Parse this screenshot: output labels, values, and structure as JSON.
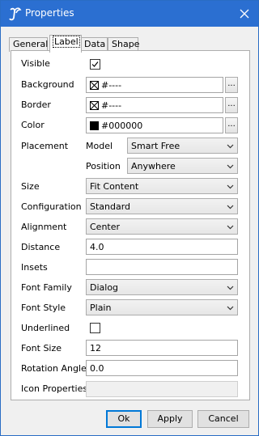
{
  "window": {
    "title": "Properties",
    "app_icon": "yed-logo-icon",
    "close_icon": "close-icon"
  },
  "tabs": [
    {
      "label": "General",
      "active": false
    },
    {
      "label": "Label",
      "active": true
    },
    {
      "label": "Data",
      "active": false
    },
    {
      "label": "Shape",
      "active": false
    }
  ],
  "form": {
    "visible": {
      "label": "Visible",
      "checked": true
    },
    "background": {
      "label": "Background",
      "value": "#----",
      "swatch": "none",
      "button": "..."
    },
    "border": {
      "label": "Border",
      "value": "#----",
      "swatch": "none",
      "button": "..."
    },
    "color": {
      "label": "Color",
      "value": "#000000",
      "swatch": "#000000",
      "button": "..."
    },
    "placement": {
      "label": "Placement",
      "model_label": "Model",
      "model_value": "Smart Free",
      "position_label": "Position",
      "position_value": "Anywhere"
    },
    "size": {
      "label": "Size",
      "value": "Fit Content"
    },
    "configuration": {
      "label": "Configuration",
      "value": "Standard"
    },
    "alignment": {
      "label": "Alignment",
      "value": "Center"
    },
    "distance": {
      "label": "Distance",
      "value": "4.0"
    },
    "insets": {
      "label": "Insets",
      "value": ""
    },
    "font_family": {
      "label": "Font Family",
      "value": "Dialog"
    },
    "font_style": {
      "label": "Font Style",
      "value": "Plain"
    },
    "underlined": {
      "label": "Underlined",
      "checked": false
    },
    "font_size": {
      "label": "Font Size",
      "value": "12"
    },
    "rotation_angle": {
      "label": "Rotation Angle",
      "value": "0.0"
    },
    "icon_properties": {
      "label": "Icon Properties",
      "value": ""
    }
  },
  "buttons": {
    "ok": "Ok",
    "apply": "Apply",
    "cancel": "Cancel"
  },
  "colors": {
    "titlebar": "#2b6fd1",
    "default_button_border": "#0078d7"
  }
}
